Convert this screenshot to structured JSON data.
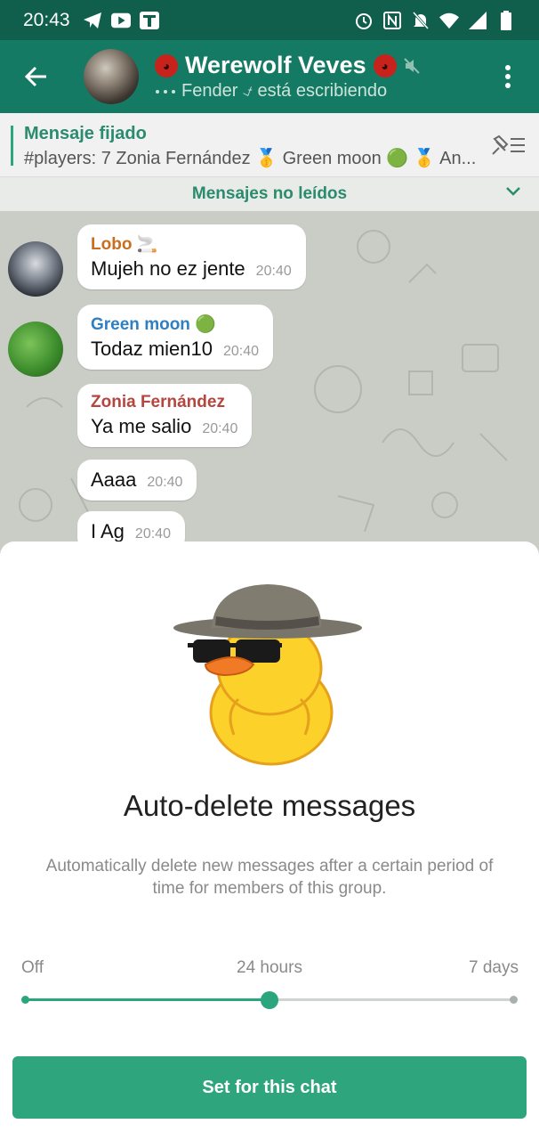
{
  "status_bar": {
    "time": "20:43"
  },
  "header": {
    "title": "Werewolf Veves",
    "typing_text": "Fender ⍻ está escribiendo"
  },
  "pinned": {
    "title": "Mensaje fijado",
    "text": "#players: 7 Zonia Fernández 🥇 Green moon 🟢 🥇 An..."
  },
  "unread_banner": {
    "label": "Mensajes no leídos"
  },
  "messages": [
    {
      "sender": "Lobo 🚬",
      "text": "Mujeh no ez jente",
      "time": "20:40",
      "color": "#c76f1e"
    },
    {
      "sender": "Green moon 🟢",
      "text": "Todaz mien10",
      "time": "20:40",
      "color": "#2f7fc1"
    },
    {
      "sender": "Zonia Fernández",
      "text": "Ya me salio",
      "time": "20:40",
      "color": "#b5453f"
    },
    {
      "sender": "",
      "text": "Aaaa",
      "time": "20:40"
    },
    {
      "sender": "",
      "text": "I Ag",
      "time": "20:40"
    }
  ],
  "sheet": {
    "title": "Auto-delete messages",
    "description": "Automatically delete new messages after a certain period of time for members of this group.",
    "slider": {
      "labels": [
        "Off",
        "24 hours",
        "7 days"
      ],
      "selected_index": 1,
      "value_fraction": 0.5
    },
    "button_label": "Set for this chat"
  },
  "colors": {
    "status_bar": "#0f5f4c",
    "app_bar": "#157a63",
    "accent": "#2aa57e"
  }
}
